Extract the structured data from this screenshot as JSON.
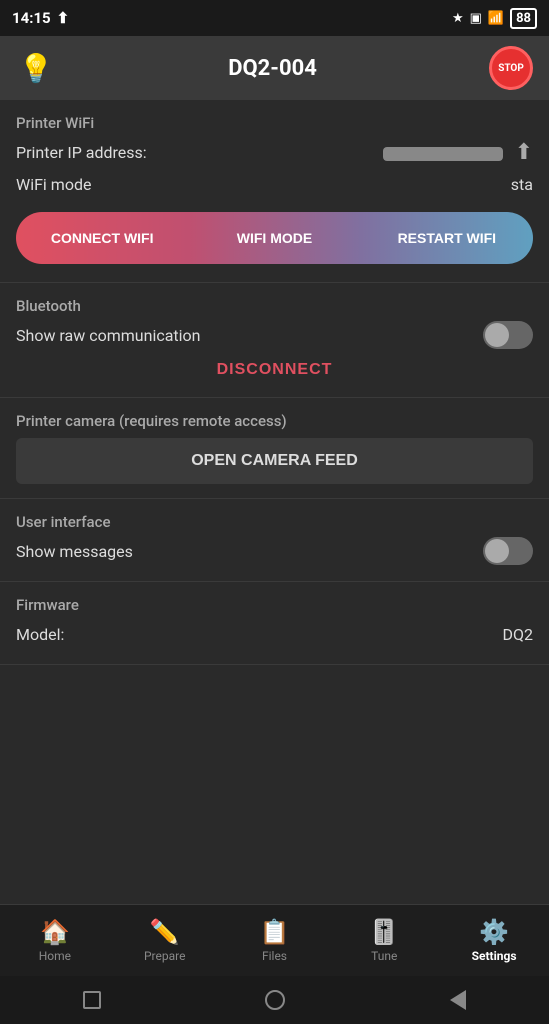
{
  "statusBar": {
    "time": "14:15",
    "uploadIcon": "⬆",
    "bluetoothIcon": "bluetooth",
    "batteryChargingIcon": "battery-charging",
    "wifiIcon": "wifi",
    "batteryLevel": "88"
  },
  "header": {
    "title": "DQ2-004",
    "lightIcon": "💡",
    "stopLabel": "STOP"
  },
  "sections": {
    "wifi": {
      "title": "Printer WiFi",
      "ipLabel": "Printer IP address:",
      "wifiModeLabel": "WiFi mode",
      "wifiModeValue": "sta",
      "buttons": {
        "connect": "CONNECT WIFI",
        "mode": "WIFI MODE",
        "restart": "RESTART WIFI"
      }
    },
    "bluetooth": {
      "title": "Bluetooth",
      "showRawLabel": "Show raw communication",
      "disconnectLabel": "DISCONNECT"
    },
    "camera": {
      "title": "Printer camera (requires remote access)",
      "openCameraLabel": "OPEN CAMERA FEED"
    },
    "userInterface": {
      "title": "User interface",
      "showMessagesLabel": "Show messages"
    },
    "firmware": {
      "title": "Firmware",
      "modelLabel": "Model:",
      "modelValue": "DQ2"
    }
  },
  "bottomNav": {
    "items": [
      {
        "id": "home",
        "label": "Home",
        "icon": "🏠",
        "active": false
      },
      {
        "id": "prepare",
        "label": "Prepare",
        "icon": "✏️",
        "active": false
      },
      {
        "id": "files",
        "label": "Files",
        "icon": "📋",
        "active": false
      },
      {
        "id": "tune",
        "label": "Tune",
        "icon": "🎚️",
        "active": false
      },
      {
        "id": "settings",
        "label": "Settings",
        "icon": "⚙️",
        "active": true
      }
    ]
  }
}
